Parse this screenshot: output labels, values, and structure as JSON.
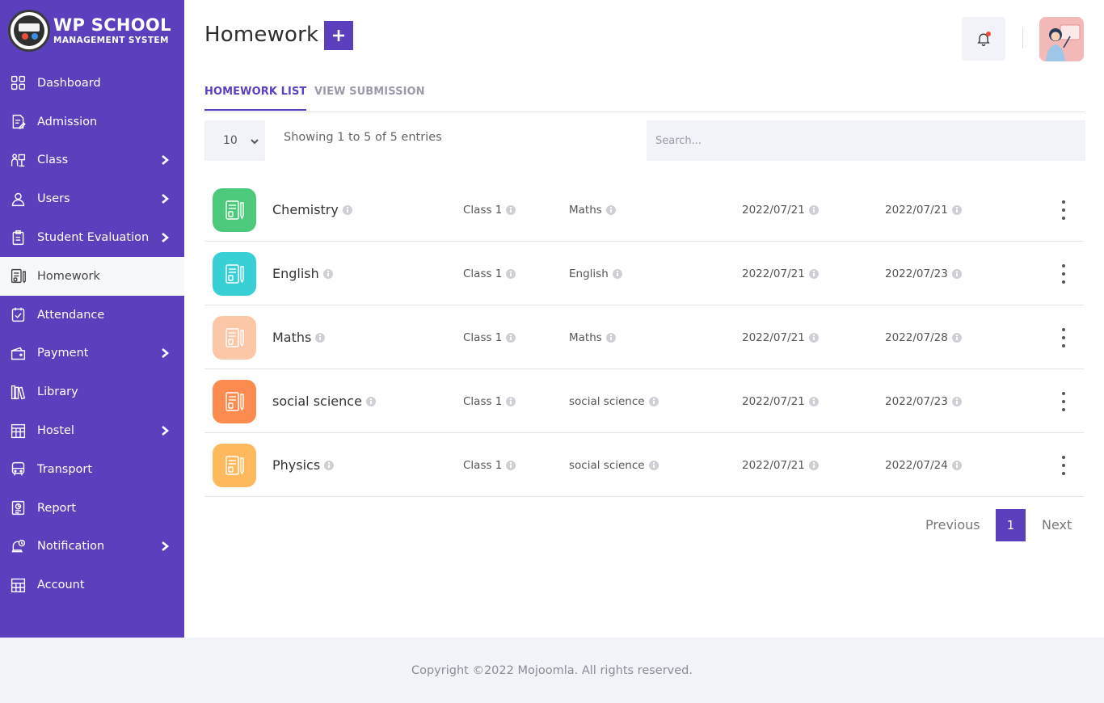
{
  "brand": {
    "title": "WP SCHOOL",
    "subtitle": "MANAGEMENT SYSTEM"
  },
  "sidebar": {
    "items": [
      {
        "label": "Dashboard",
        "icon": "dashboard-icon",
        "has_submenu": false
      },
      {
        "label": "Admission",
        "icon": "admission-icon",
        "has_submenu": false
      },
      {
        "label": "Class",
        "icon": "class-icon",
        "has_submenu": true
      },
      {
        "label": "Users",
        "icon": "user-icon",
        "has_submenu": true
      },
      {
        "label": "Student Evaluation",
        "icon": "evaluation-icon",
        "has_submenu": true
      },
      {
        "label": "Homework",
        "icon": "homework-icon",
        "has_submenu": false,
        "active": true
      },
      {
        "label": "Attendance",
        "icon": "attendance-icon",
        "has_submenu": false
      },
      {
        "label": "Payment",
        "icon": "wallet-icon",
        "has_submenu": true
      },
      {
        "label": "Library",
        "icon": "library-icon",
        "has_submenu": false
      },
      {
        "label": "Hostel",
        "icon": "hostel-icon",
        "has_submenu": true
      },
      {
        "label": "Transport",
        "icon": "bus-icon",
        "has_submenu": false
      },
      {
        "label": "Report",
        "icon": "report-icon",
        "has_submenu": false
      },
      {
        "label": "Notification",
        "icon": "notification-icon",
        "has_submenu": true
      },
      {
        "label": "Account",
        "icon": "account-icon",
        "has_submenu": false
      }
    ]
  },
  "header": {
    "title": "Homework"
  },
  "tabs": [
    {
      "label": "HOMEWORK LIST",
      "active": true
    },
    {
      "label": "VIEW SUBMISSION",
      "active": false
    }
  ],
  "table": {
    "page_length": "10",
    "info": "Showing 1 to 5 of 5 entries",
    "search_placeholder": "Search...",
    "rows": [
      {
        "title": "Chemistry",
        "class": "Class 1",
        "subject": "Maths",
        "start_date": "2022/07/21",
        "end_date": "2022/07/21",
        "color": "#4cc97a"
      },
      {
        "title": "English",
        "class": "Class 1",
        "subject": "English",
        "start_date": "2022/07/21",
        "end_date": "2022/07/23",
        "color": "#38cfd5"
      },
      {
        "title": "Maths",
        "class": "Class 1",
        "subject": "Maths",
        "start_date": "2022/07/21",
        "end_date": "2022/07/28",
        "color": "#fcc7a6"
      },
      {
        "title": "social science",
        "class": "Class 1",
        "subject": "social science",
        "start_date": "2022/07/21",
        "end_date": "2022/07/23",
        "color": "#fb8b4e"
      },
      {
        "title": "Physics",
        "class": "Class 1",
        "subject": "social science",
        "start_date": "2022/07/21",
        "end_date": "2022/07/24",
        "color": "#fdb95c"
      }
    ]
  },
  "pagination": {
    "previous": "Previous",
    "current": "1",
    "next": "Next"
  },
  "footer": {
    "text": "Copyright ©2022 Mojoomla. All rights reserved."
  },
  "colors": {
    "accent": "#5c3fbd",
    "panel": "#f1f3f8"
  }
}
